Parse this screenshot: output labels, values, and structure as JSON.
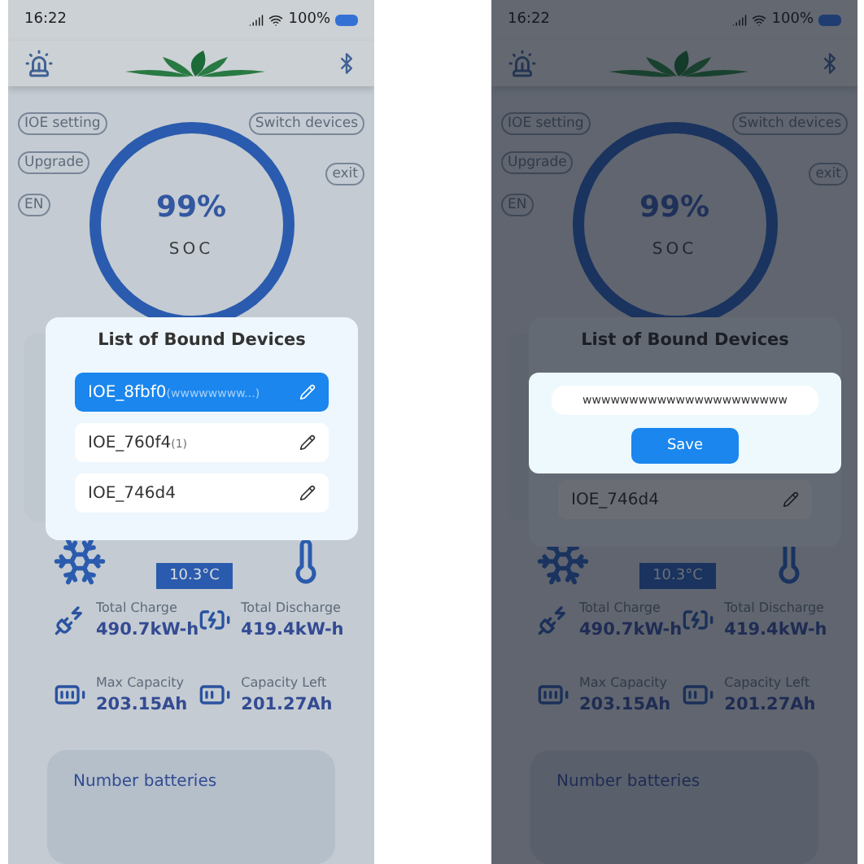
{
  "phones": [
    {
      "status_bar": {
        "time": "16:22",
        "battery": "100%"
      },
      "controls": {
        "left": [
          "IOE setting",
          "Upgrade",
          "EN"
        ],
        "right": [
          "Switch devices",
          "exit"
        ]
      },
      "gauge": {
        "value": "99%",
        "label": "SOC"
      },
      "temperature": "10.3°C",
      "stats": [
        {
          "kind": "charge",
          "label": "Total Charge",
          "value": "490.7kW-h"
        },
        {
          "kind": "discharge",
          "label": "Total Discharge",
          "value": "419.4kW-h"
        },
        {
          "kind": "full",
          "label": "Max Capacity",
          "value": "203.15Ah"
        },
        {
          "kind": "partial",
          "label": "Capacity Left",
          "value": "201.27Ah"
        }
      ],
      "bottom_card": "Number batteries",
      "dialog": {
        "kind": "list",
        "title": "List of Bound Devices",
        "devices": [
          {
            "name": "IOE_8fbf0",
            "note": "(wwwwwwww...)",
            "selected": true
          },
          {
            "name": "IOE_760f4",
            "note": "(1)",
            "selected": false
          },
          {
            "name": "IOE_746d4",
            "selected": false
          }
        ]
      }
    },
    {
      "status_bar": {
        "time": "16:22",
        "battery": "100%"
      },
      "controls": {
        "left": [
          "IOE setting",
          "Upgrade",
          "EN"
        ],
        "right": [
          "Switch devices",
          "exit"
        ]
      },
      "gauge": {
        "value": "99%",
        "label": "SOC"
      },
      "temperature": "10.3°C",
      "stats": [
        {
          "kind": "charge",
          "label": "Total Charge",
          "value": "490.7kW-h"
        },
        {
          "kind": "discharge",
          "label": "Total Discharge",
          "value": "419.4kW-h"
        },
        {
          "kind": "full",
          "label": "Max Capacity",
          "value": "203.15Ah"
        },
        {
          "kind": "partial",
          "label": "Capacity Left",
          "value": "201.27Ah"
        }
      ],
      "bottom_card": "Number batteries",
      "dialog": {
        "kind": "edit",
        "title": "List of Bound Devices",
        "field_value": "wwwwwwwwwwwwwwwwwwwwww",
        "save": "Save",
        "devices": [
          {
            "name": "IOE_746d4",
            "selected": false
          }
        ]
      }
    }
  ]
}
